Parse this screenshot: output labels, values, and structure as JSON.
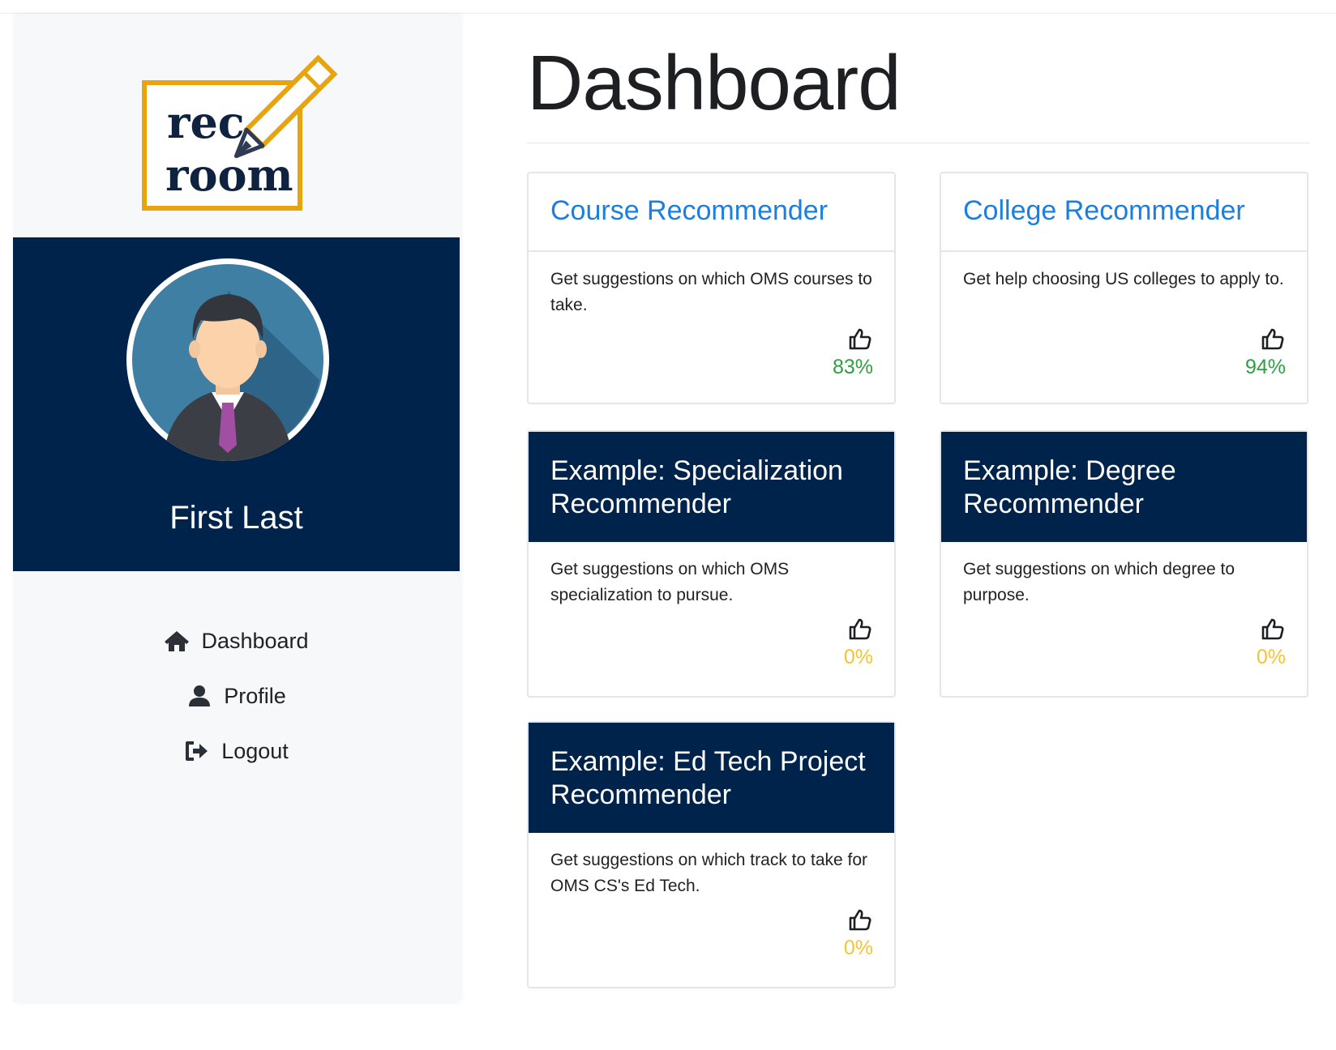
{
  "app": {
    "logo_text_line1": "rec",
    "logo_text_line2": "room"
  },
  "sidebar": {
    "user_name": "First Last",
    "nav": [
      {
        "label": "Dashboard",
        "icon": "home-icon"
      },
      {
        "label": "Profile",
        "icon": "user-icon"
      },
      {
        "label": "Logout",
        "icon": "logout-icon"
      }
    ]
  },
  "main": {
    "title": "Dashboard",
    "cards": [
      {
        "title": "Course Recommender",
        "description": "Get suggestions on which OMS courses to take.",
        "rating": "83%",
        "rating_color": "#2f9e44",
        "style": "light",
        "icon": "thumbs-up-icon"
      },
      {
        "title": "College Recommender",
        "description": "Get help choosing US colleges to apply to.",
        "rating": "94%",
        "rating_color": "#2f9e44",
        "style": "light",
        "icon": "thumbs-up-icon"
      },
      {
        "title": "Example: Specialization Recommender",
        "description": "Get suggestions on which OMS specialization to pursue.",
        "rating": "0%",
        "rating_color": "#f2c531",
        "style": "dark",
        "icon": "thumbs-up-icon"
      },
      {
        "title": "Example: Degree Recommender",
        "description": "Get suggestions on which degree to purpose.",
        "rating": "0%",
        "rating_color": "#f2c531",
        "style": "dark",
        "icon": "thumbs-up-icon"
      },
      {
        "title": "Example: Ed Tech Project Recommender",
        "description": "Get suggestions on which track to take for OMS CS's Ed Tech.",
        "rating": "0%",
        "rating_color": "#f2c531",
        "style": "dark",
        "icon": "thumbs-up-icon"
      }
    ]
  },
  "colors": {
    "navy": "#00234b",
    "link_blue": "#1a7fe0",
    "logo_gold": "#e8a40c"
  }
}
